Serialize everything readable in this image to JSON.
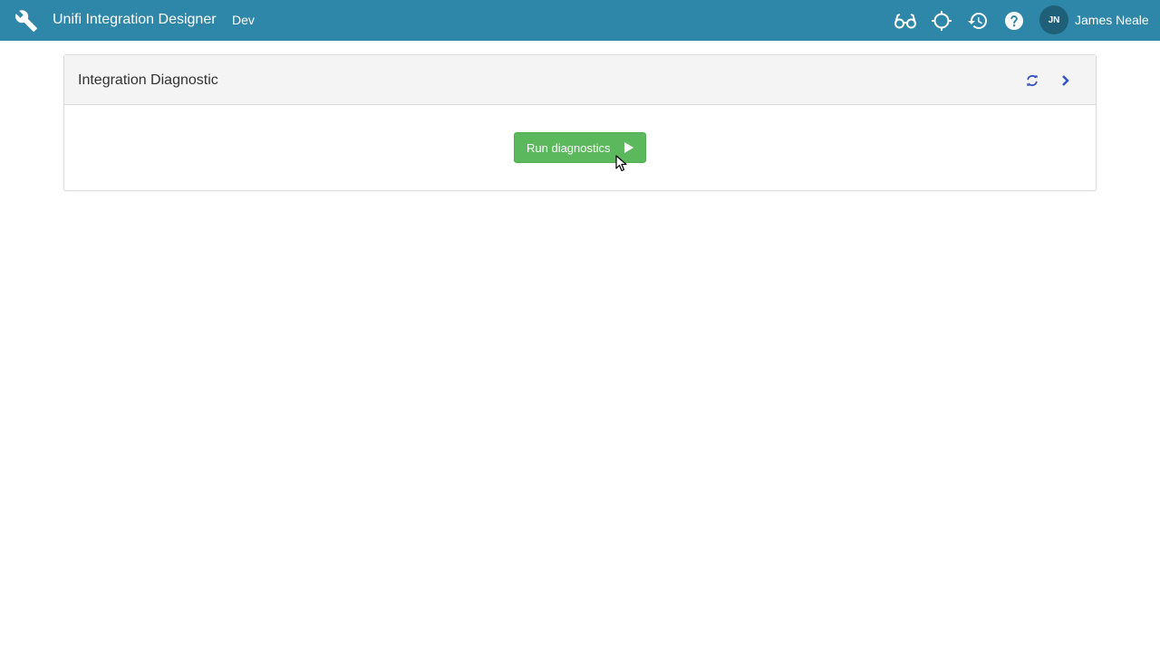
{
  "header": {
    "app_title": "Unifi Integration Designer",
    "environment": "Dev",
    "logo_icon": "wrench-icon",
    "icons": [
      "glasses-icon",
      "crosshair-icon",
      "history-icon",
      "help-icon"
    ],
    "user": {
      "initials": "JN",
      "name": "James Neale"
    },
    "bar_color": "#2e86a8"
  },
  "panel": {
    "title": "Integration Diagnostic",
    "refresh_icon": "refresh-icon",
    "expand_icon": "chevron-right-icon",
    "icon_color": "#3352c6"
  },
  "actions": {
    "run_label": "Run diagnostics",
    "run_icon": "play-icon",
    "run_color": "#5cb85c"
  }
}
